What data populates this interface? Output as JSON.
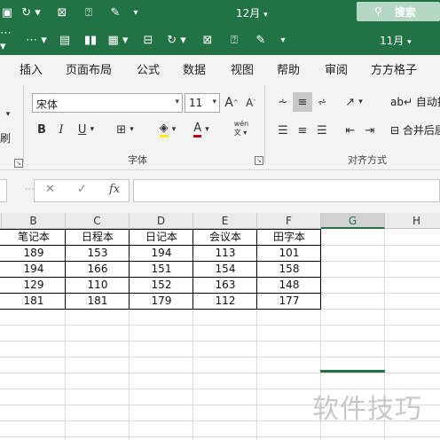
{
  "window": {
    "title": "12月",
    "title_arrow": "▾",
    "search_label": "搜索"
  },
  "qat": {
    "month": "11月"
  },
  "tabs": [
    "插入",
    "页面布局",
    "公式",
    "数据",
    "视图",
    "帮助",
    "审阅",
    "方方格子"
  ],
  "ribbon": {
    "font_name": "宋体",
    "font_size": "11",
    "font_group_label": "字体",
    "align_group_label": "对齐方式",
    "wrap_text": "自动换行",
    "merge_center": "合并后居中",
    "side_label": "刷"
  },
  "formula_bar": {
    "cancel": "✕",
    "enter": "✓",
    "fx": "fx",
    "value": ""
  },
  "sheet": {
    "columns": [
      "B",
      "C",
      "D",
      "E",
      "F",
      "G",
      "H"
    ],
    "selected_column": "G",
    "headers": [
      "笔记本",
      "日程本",
      "日记本",
      "会议本",
      "田字本"
    ],
    "rows": [
      [
        "189",
        "153",
        "194",
        "113",
        "101"
      ],
      [
        "194",
        "166",
        "151",
        "154",
        "158"
      ],
      [
        "129",
        "110",
        "152",
        "163",
        "148"
      ],
      [
        "181",
        "181",
        "179",
        "112",
        "177"
      ]
    ]
  },
  "watermark": "软件技巧",
  "colors": {
    "excel_green": "#217346",
    "font_color_red": "#c00000",
    "highlight_yellow": "#ffeb00"
  }
}
